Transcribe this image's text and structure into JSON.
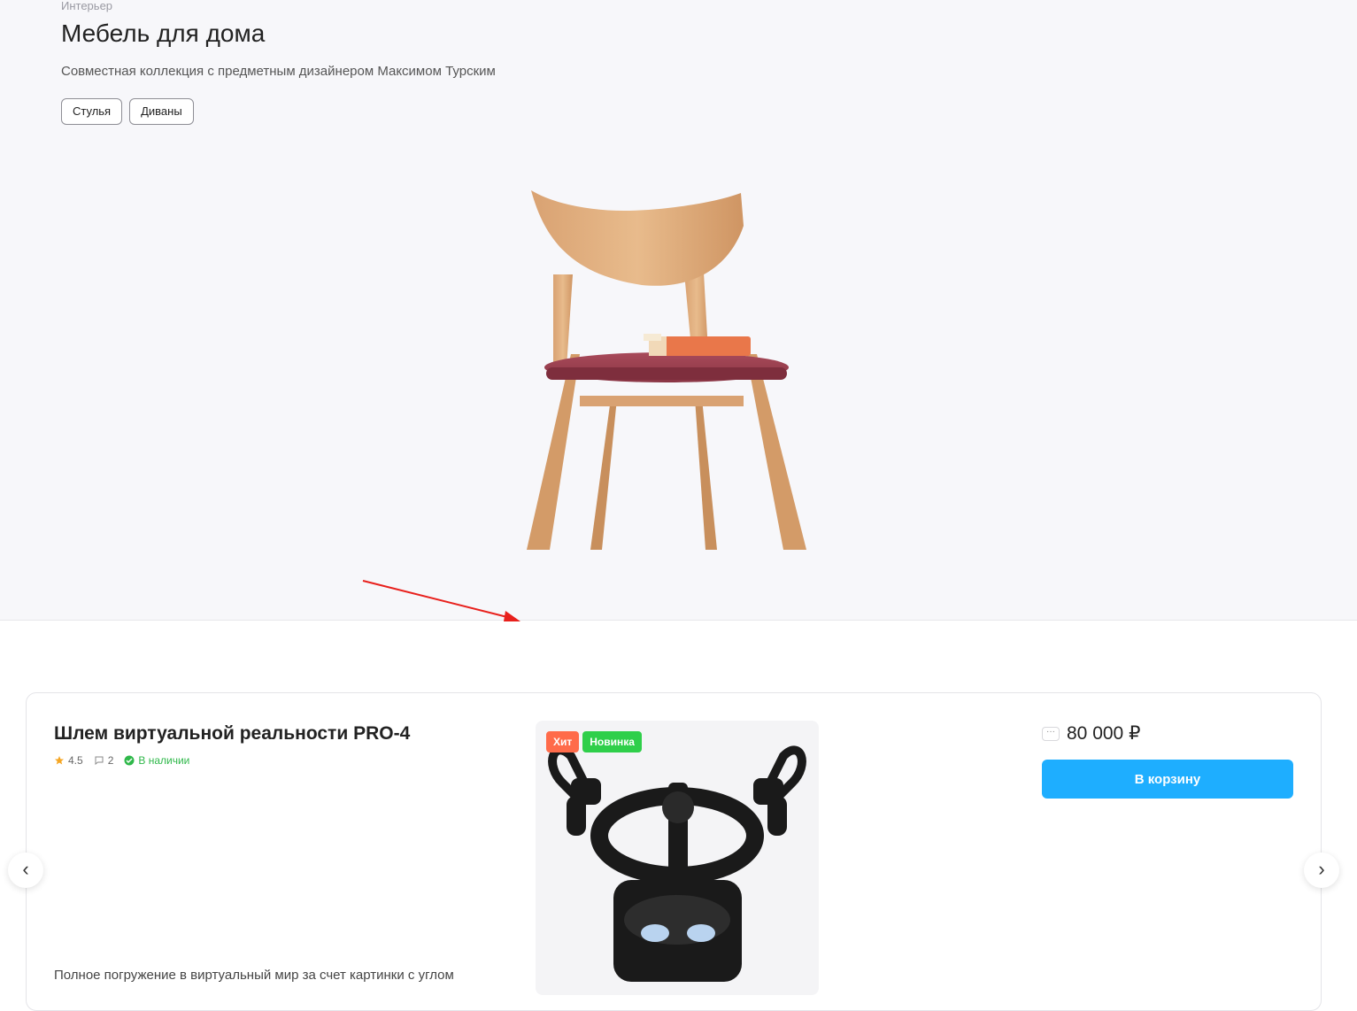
{
  "hero": {
    "eyebrow": "Интерьер",
    "title": "Мебель для дома",
    "subtitle": "Совместная коллекция с предметным дизайнером Максимом Турским",
    "tags": [
      "Стулья",
      "Диваны"
    ]
  },
  "product": {
    "title": "Шлем виртуальной реальности PRO-4",
    "rating": "4.5",
    "reviews": "2",
    "stock": "В наличии",
    "badges": [
      {
        "label": "Хит",
        "color": "#ff6b4a"
      },
      {
        "label": "Новинка",
        "color": "#2fcf4a"
      }
    ],
    "price": "80 000 ₽",
    "price_more": "···",
    "cart_label": "В корзину",
    "description": "Полное погружение в виртуальный мир за счет картинки с углом"
  },
  "carousel": {
    "prev": "‹",
    "next": "›"
  },
  "colors": {
    "accent": "#1eaeff",
    "stock": "#2fb84a",
    "annotation_arrow": "#e8201c"
  }
}
